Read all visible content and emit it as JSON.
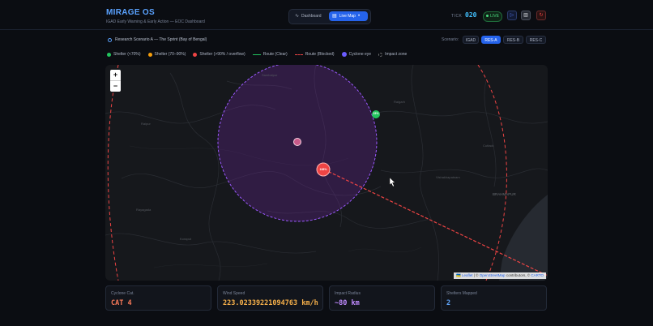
{
  "app": {
    "title": "MIRAGE OS",
    "subtitle": "IGAD Early Warning & Early Action — EOC Dashboard"
  },
  "nav": {
    "dashboard_label": "Dashboard",
    "livemap_label": "Live Map"
  },
  "status": {
    "tick_label": "TICK",
    "tick_value": "020",
    "live_label": "LIVE"
  },
  "scenario": {
    "title": "Research Scenario A — The Sprint (Bay of Bengal)",
    "label": "Scenario:",
    "options": [
      "IGAD",
      "RES-A",
      "RES-B",
      "RES-C"
    ],
    "selected": "RES-A"
  },
  "legend": {
    "items": [
      {
        "label": "Shelter (<70%)",
        "color": "#22c55e",
        "kind": "dot"
      },
      {
        "label": "Shelter (70–90%)",
        "color": "#f59e0b",
        "kind": "dot"
      },
      {
        "label": "Shelter (>90% / overflow)",
        "color": "#ef4444",
        "kind": "dot"
      },
      {
        "label": "Route (Clear)",
        "color": "#22c55e",
        "kind": "line"
      },
      {
        "label": "Route (Blocked)",
        "color": "#ef4444",
        "kind": "dash"
      },
      {
        "label": "Cyclone eye",
        "color": "#6b5cff",
        "kind": "eye"
      },
      {
        "label": "Impact zone",
        "color": "#777777",
        "kind": "ring"
      }
    ]
  },
  "map": {
    "zoom_in": "+",
    "zoom_out": "−",
    "markers": [
      {
        "label": "23%",
        "color": "#22c55e"
      },
      {
        "label": "108%",
        "color": "#ef4444"
      }
    ],
    "place_labels": [
      "Sambalpur",
      "Raipur",
      "Raigarh",
      "Cuttack",
      "Vishakhapatnam",
      "BRAHMAPUR",
      "Rayagada",
      "Koraput"
    ],
    "attribution": {
      "prefix": "🇺🇦",
      "leaflet": "Leaflet",
      "sep": "|",
      "copy": "©",
      "osm": "OpenStreetMap",
      "contrib": "contributors, ©",
      "carto": "CARTO"
    }
  },
  "stats": [
    {
      "key": "Cyclone Cat.",
      "value": "CAT 4",
      "color": "#fb7a5a"
    },
    {
      "key": "Wind Speed",
      "value": "223.02339221094763 km/h",
      "color": "#f6b04a"
    },
    {
      "key": "Impact Radius",
      "value": "~80 km",
      "color": "#c08bff"
    },
    {
      "key": "Shelters Mapped",
      "value": "2",
      "color": "#60a5fa"
    }
  ],
  "colors": {
    "accent": "#2563eb",
    "impact_zone": "#9b59ff",
    "route_blocked": "#ef4444"
  }
}
